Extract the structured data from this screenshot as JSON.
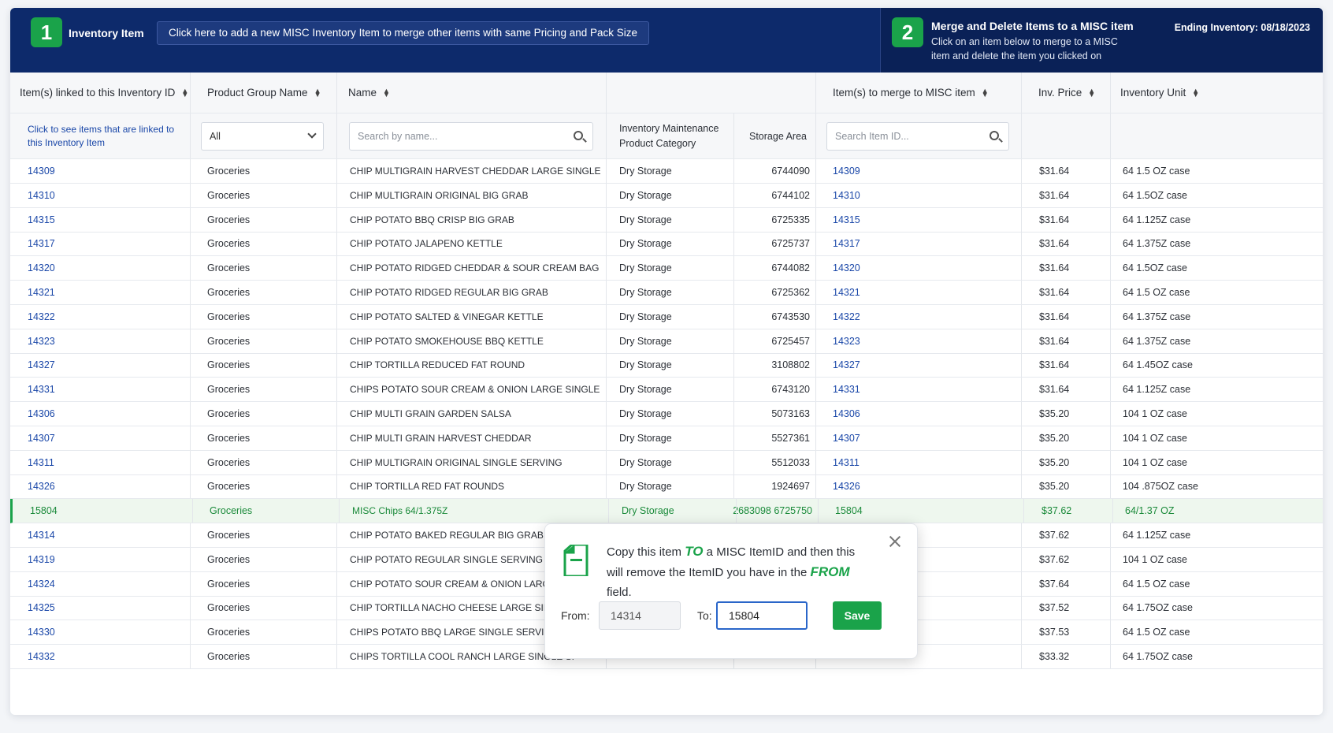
{
  "header": {
    "step1_number": "1",
    "step1_title": "Inventory Item",
    "add_misc_label": "Click here to add a new MISC Inventory Item to merge other items with same Pricing and Pack Size",
    "step2_number": "2",
    "step2_title": "Merge and Delete Items to a MISC item",
    "step2_subtitle": "Click on an item below to merge to a MISC item and delete the item you clicked on",
    "ending_inventory": "Ending Inventory: 08/18/2023"
  },
  "columns": {
    "linked_id": "Item(s) linked to this Inventory ID",
    "product_group": "Product Group Name",
    "name": "Name",
    "category": "Inventory Maintenance Product Category",
    "storage_area": "Storage Area",
    "merge_id": "Item(s) to merge to MISC item",
    "inv_price": "Inv. Price",
    "inv_unit": "Inventory Unit"
  },
  "filters": {
    "linked_hint": "Click to see items that are linked to this Inventory Item",
    "group_selected": "All",
    "name_placeholder": "Search by name...",
    "item_id_placeholder": "Search Item ID..."
  },
  "rows": [
    {
      "id": "14309",
      "group": "Groceries",
      "name": "CHIP MULTIGRAIN HARVEST CHEDDAR LARGE SINGLE SERVING",
      "category": "Dry Storage",
      "storage": "6744090",
      "merge": "14309",
      "price": "$31.64",
      "unit": "64 1.5 OZ case"
    },
    {
      "id": "14310",
      "group": "Groceries",
      "name": "CHIP MULTIGRAIN ORIGINAL BIG GRAB",
      "category": "Dry Storage",
      "storage": "6744102",
      "merge": "14310",
      "price": "$31.64",
      "unit": "64 1.5OZ case"
    },
    {
      "id": "14315",
      "group": "Groceries",
      "name": "CHIP POTATO BBQ CRISP BIG GRAB",
      "category": "Dry Storage",
      "storage": "6725335",
      "merge": "14315",
      "price": "$31.64",
      "unit": "64 1.125Z case"
    },
    {
      "id": "14317",
      "group": "Groceries",
      "name": "CHIP POTATO JALAPENO KETTLE",
      "category": "Dry Storage",
      "storage": "6725737",
      "merge": "14317",
      "price": "$31.64",
      "unit": "64 1.375Z case"
    },
    {
      "id": "14320",
      "group": "Groceries",
      "name": "CHIP POTATO RIDGED CHEDDAR & SOUR CREAM BAG",
      "category": "Dry Storage",
      "storage": "6744082",
      "merge": "14320",
      "price": "$31.64",
      "unit": "64 1.5OZ case"
    },
    {
      "id": "14321",
      "group": "Groceries",
      "name": "CHIP POTATO RIDGED REGULAR BIG GRAB",
      "category": "Dry Storage",
      "storage": "6725362",
      "merge": "14321",
      "price": "$31.64",
      "unit": "64 1.5 OZ case"
    },
    {
      "id": "14322",
      "group": "Groceries",
      "name": "CHIP POTATO SALTED & VINEGAR KETTLE",
      "category": "Dry Storage",
      "storage": "6743530",
      "merge": "14322",
      "price": "$31.64",
      "unit": "64 1.375Z case"
    },
    {
      "id": "14323",
      "group": "Groceries",
      "name": "CHIP POTATO SMOKEHOUSE BBQ KETTLE",
      "category": "Dry Storage",
      "storage": "6725457",
      "merge": "14323",
      "price": "$31.64",
      "unit": "64 1.375Z case"
    },
    {
      "id": "14327",
      "group": "Groceries",
      "name": "CHIP TORTILLA REDUCED FAT ROUND",
      "category": "Dry Storage",
      "storage": "3108802",
      "merge": "14327",
      "price": "$31.64",
      "unit": "64 1.45OZ case"
    },
    {
      "id": "14331",
      "group": "Groceries",
      "name": "CHIPS POTATO SOUR CREAM & ONION LARGE SINGLE SERVING",
      "category": "Dry Storage",
      "storage": "6743120",
      "merge": "14331",
      "price": "$31.64",
      "unit": "64 1.125Z case"
    },
    {
      "id": "14306",
      "group": "Groceries",
      "name": "CHIP MULTI GRAIN GARDEN SALSA",
      "category": "Dry Storage",
      "storage": "5073163",
      "merge": "14306",
      "price": "$35.20",
      "unit": "104 1 OZ case"
    },
    {
      "id": "14307",
      "group": "Groceries",
      "name": "CHIP MULTI GRAIN HARVEST CHEDDAR",
      "category": "Dry Storage",
      "storage": "5527361",
      "merge": "14307",
      "price": "$35.20",
      "unit": "104 1 OZ case"
    },
    {
      "id": "14311",
      "group": "Groceries",
      "name": "CHIP MULTIGRAIN ORIGINAL SINGLE SERVING",
      "category": "Dry Storage",
      "storage": "5512033",
      "merge": "14311",
      "price": "$35.20",
      "unit": "104 1 OZ case"
    },
    {
      "id": "14326",
      "group": "Groceries",
      "name": "CHIP TORTILLA RED FAT ROUNDS",
      "category": "Dry Storage",
      "storage": "1924697",
      "merge": "14326",
      "price": "$35.20",
      "unit": "104 .875OZ case"
    },
    {
      "id": "15804",
      "group": "Groceries",
      "name": "MISC Chips 64/1.375Z",
      "category": "Dry Storage",
      "storage": "2683098 6725750",
      "merge": "15804",
      "price": "$37.62",
      "unit": "64/1.37 OZ",
      "highlight": true
    },
    {
      "id": "14314",
      "group": "Groceries",
      "name": "CHIP POTATO BAKED REGULAR BIG GRAB",
      "category": "",
      "storage": "",
      "merge": "",
      "price": "$37.62",
      "unit": "64 1.125Z case"
    },
    {
      "id": "14319",
      "group": "Groceries",
      "name": "CHIP POTATO REGULAR SINGLE SERVING",
      "category": "",
      "storage": "",
      "merge": "",
      "price": "$37.62",
      "unit": "104 1 OZ case"
    },
    {
      "id": "14324",
      "group": "Groceries",
      "name": "CHIP POTATO SOUR CREAM & ONION LARGE SIN",
      "category": "",
      "storage": "",
      "merge": "",
      "price": "$37.64",
      "unit": "64 1.5 OZ case"
    },
    {
      "id": "14325",
      "group": "Groceries",
      "name": "CHIP TORTILLA NACHO CHEESE LARGE SINGLE S",
      "category": "",
      "storage": "",
      "merge": "",
      "price": "$37.52",
      "unit": "64 1.75OZ case"
    },
    {
      "id": "14330",
      "group": "Groceries",
      "name": "CHIPS POTATO BBQ LARGE SINGLE SERVING",
      "category": "",
      "storage": "",
      "merge": "",
      "price": "$37.53",
      "unit": "64 1.5 OZ case"
    },
    {
      "id": "14332",
      "group": "Groceries",
      "name": "CHIPS TORTILLA COOL RANCH LARGE SINGLE SI",
      "category": "",
      "storage": "",
      "merge": "",
      "price": "$33.32",
      "unit": "64 1.75OZ case"
    }
  ],
  "popup": {
    "text_1": "Copy this item ",
    "text_to": "TO",
    "text_2": " a MISC ItemID and then this will remove the ItemID you have in the ",
    "text_from": "FROM",
    "text_3": " field.",
    "from_label": "From:",
    "from_value": "14314",
    "to_label": "To:",
    "to_value": "15804",
    "save_label": "Save"
  },
  "colors": {
    "header_bg": "#0d2a6b",
    "accent_green": "#1aa34a",
    "link_blue": "#1a47a8"
  }
}
